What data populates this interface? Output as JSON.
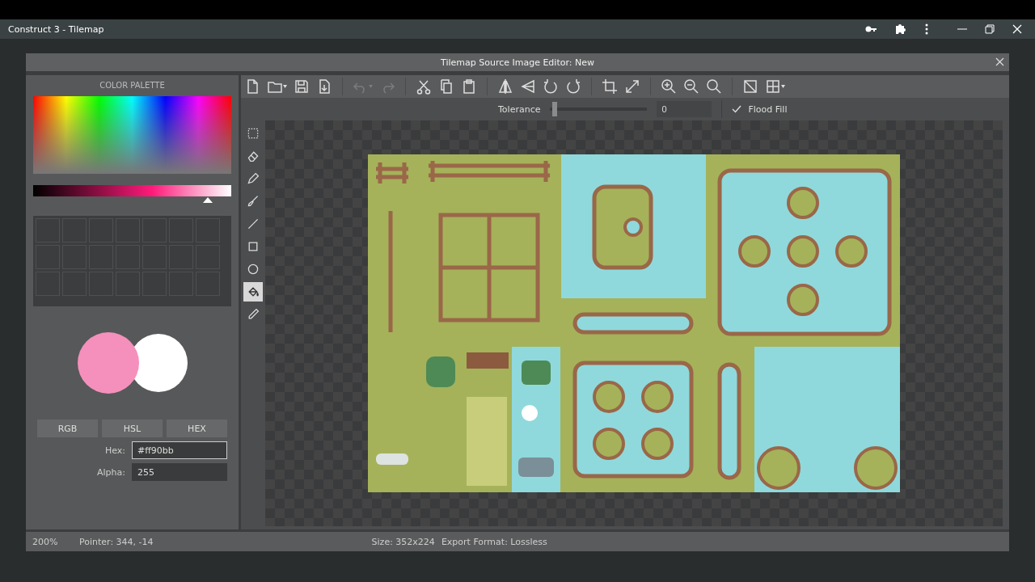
{
  "app_window": {
    "title": "Construct 3 - Tilemap"
  },
  "dialog": {
    "title": "Tilemap Source Image Editor: New"
  },
  "palette": {
    "title": "COLOR PALETTE",
    "shade": {
      "level": 0.88
    },
    "modes": [
      {
        "label": "RGB"
      },
      {
        "label": "HSL"
      },
      {
        "label": "HEX"
      }
    ],
    "fields": [
      {
        "label": "Hex:",
        "value": "#ff90bb",
        "focused": true
      },
      {
        "label": "Alpha:",
        "value": "255",
        "focused": false
      }
    ]
  },
  "toolbar": [
    [
      {
        "kind": "new",
        "disabled": false
      },
      {
        "kind": "open",
        "disabled": false
      },
      {
        "kind": "save",
        "disabled": false
      },
      {
        "kind": "export",
        "disabled": false
      }
    ],
    [
      {
        "kind": "undo",
        "disabled": true
      },
      {
        "kind": "redo",
        "disabled": true
      }
    ],
    [
      {
        "kind": "cut",
        "disabled": false
      },
      {
        "kind": "copy",
        "disabled": false
      },
      {
        "kind": "paste",
        "disabled": false
      }
    ],
    [
      {
        "kind": "flip-h",
        "disabled": false
      },
      {
        "kind": "flip-v",
        "disabled": false
      },
      {
        "kind": "rotate-ccw",
        "disabled": false
      },
      {
        "kind": "rotate-cw",
        "disabled": false
      }
    ],
    [
      {
        "kind": "crop",
        "disabled": false
      },
      {
        "kind": "resize",
        "disabled": false
      }
    ],
    [
      {
        "kind": "zoom-in",
        "disabled": false
      },
      {
        "kind": "zoom-out",
        "disabled": false
      },
      {
        "kind": "zoom-reset",
        "disabled": false
      }
    ],
    [
      {
        "kind": "color-mode",
        "disabled": false
      },
      {
        "kind": "grid",
        "disabled": false
      }
    ]
  ],
  "options": {
    "tolerance_label": "Tolerance",
    "tolerance": {
      "level": 0.02
    },
    "tolerance_value": "0",
    "flood_fill": {
      "label": "Flood Fill",
      "checked": true
    }
  },
  "tools": [
    {
      "kind": "select",
      "selected": false
    },
    {
      "kind": "eraser",
      "selected": false
    },
    {
      "kind": "pencil",
      "selected": false
    },
    {
      "kind": "brush",
      "selected": false
    },
    {
      "kind": "line",
      "selected": false
    },
    {
      "kind": "rect",
      "selected": false
    },
    {
      "kind": "ellipse",
      "selected": false
    },
    {
      "kind": "fill",
      "selected": true
    },
    {
      "kind": "picker",
      "selected": false
    }
  ],
  "status_bar": {
    "zoom": "200%",
    "pointer": "Pointer: 344, -14",
    "size": "Size: 352x224",
    "export_format": "Export Format: Lossless"
  }
}
